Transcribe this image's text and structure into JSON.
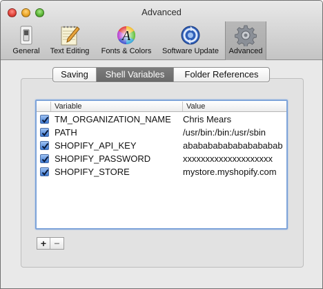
{
  "window": {
    "title": "Advanced"
  },
  "toolbar": {
    "items": [
      {
        "label": "General",
        "icon": "light-switch-icon",
        "active": false
      },
      {
        "label": "Text Editing",
        "icon": "notepad-pencil-icon",
        "active": false
      },
      {
        "label": "Fonts & Colors",
        "icon": "color-wheel-font-icon",
        "active": false
      },
      {
        "label": "Software Update",
        "icon": "update-sync-icon",
        "active": false
      },
      {
        "label": "Advanced",
        "icon": "gear-icon",
        "active": true
      }
    ]
  },
  "tabs": {
    "items": [
      "Saving",
      "Shell Variables",
      "Folder References"
    ],
    "selected": "Shell Variables"
  },
  "table": {
    "columns": {
      "variable": "Variable",
      "value": "Value"
    },
    "rows": [
      {
        "enabled": true,
        "variable": "TM_ORGANIZATION_NAME",
        "value": "Chris Mears"
      },
      {
        "enabled": true,
        "variable": "PATH",
        "value": "/usr/bin:/bin:/usr/sbin"
      },
      {
        "enabled": true,
        "variable": "SHOPIFY_API_KEY",
        "value": "abababababababababab"
      },
      {
        "enabled": true,
        "variable": "SHOPIFY_PASSWORD",
        "value": "xxxxxxxxxxxxxxxxxxxx"
      },
      {
        "enabled": true,
        "variable": "SHOPIFY_STORE",
        "value": "mystore.myshopify.com"
      }
    ]
  },
  "buttons": {
    "add": "+",
    "remove": "−"
  },
  "colors": {
    "selection_accent": "#3c78d0",
    "focus_ring": "#7da3d9",
    "selected_tab": "#6f6f6f"
  }
}
